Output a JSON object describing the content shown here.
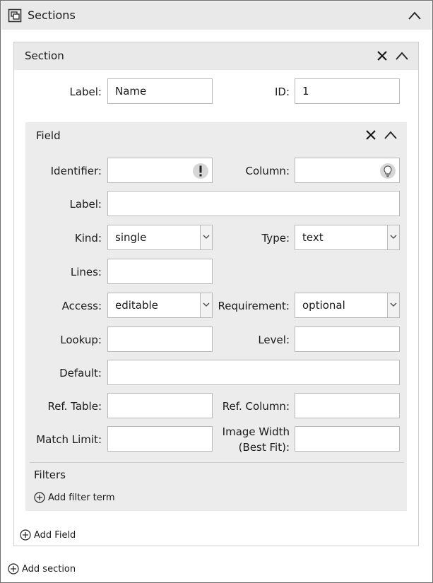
{
  "panel": {
    "title": "Sections",
    "header_icon": "sections-icon",
    "collapse_icon": "chevron-up-icon"
  },
  "section": {
    "title": "Section",
    "close_icon": "close-icon",
    "collapse_icon": "chevron-up-icon",
    "label_label": "Label:",
    "label_value": "Name",
    "id_label": "ID:",
    "id_value": "1",
    "add_field_label": "Add Field"
  },
  "field": {
    "title": "Field",
    "identifier_label": "Identifier:",
    "identifier_value": "",
    "identifier_icon": "exclamation-icon",
    "column_label": "Column:",
    "column_value": "",
    "column_icon": "lightbulb-icon",
    "label_label": "Label:",
    "label_value": "",
    "kind_label": "Kind:",
    "kind_value": "single",
    "type_label": "Type:",
    "type_value": "text",
    "lines_label": "Lines:",
    "lines_value": "",
    "access_label": "Access:",
    "access_value": "editable",
    "requirement_label": "Requirement:",
    "requirement_value": "optional",
    "lookup_label": "Lookup:",
    "lookup_value": "",
    "level_label": "Level:",
    "level_value": "",
    "default_label": "Default:",
    "default_value": "",
    "ref_table_label": "Ref. Table:",
    "ref_table_value": "",
    "ref_column_label": "Ref. Column:",
    "ref_column_value": "",
    "match_limit_label": "Match Limit:",
    "match_limit_value": "",
    "image_width_label_line1": "Image Width",
    "image_width_label_line2": "(Best Fit):",
    "image_width_value": "",
    "filters_title": "Filters",
    "add_filter_label": "Add filter term"
  },
  "footer": {
    "add_section_label": "Add section"
  },
  "colors": {
    "header_bg": "#e9e9e9",
    "field_bg": "#ececec",
    "border": "#b8b8b8"
  }
}
